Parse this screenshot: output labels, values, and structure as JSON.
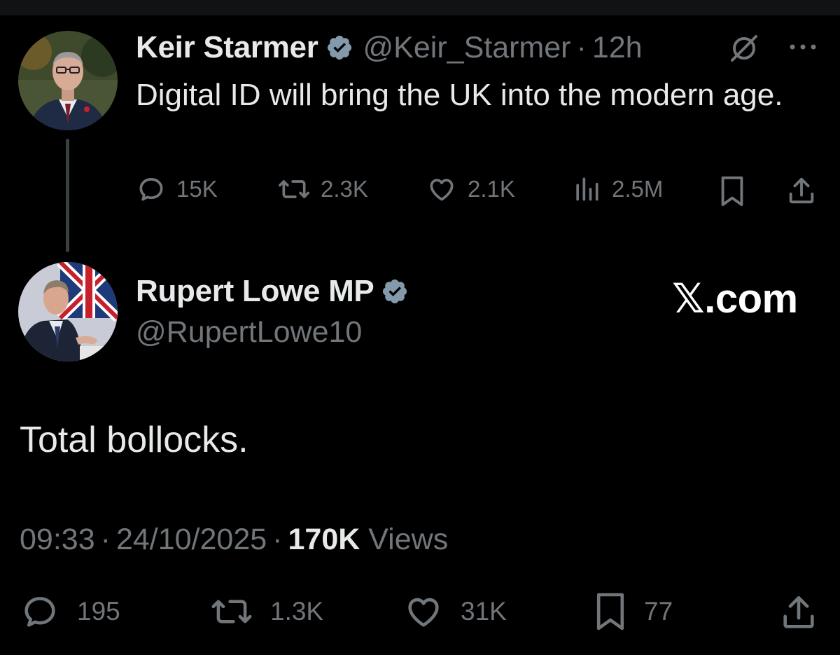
{
  "parent_tweet": {
    "author_name": "Keir Starmer",
    "handle": "@Keir_Starmer",
    "separator": "·",
    "time": "12h",
    "text": "Digital ID will bring the UK into the modern age.",
    "stats": {
      "replies": "15K",
      "reposts": "2.3K",
      "likes": "2.1K",
      "views": "2.5M"
    },
    "icons": [
      "reply-icon",
      "repost-icon",
      "like-icon",
      "views-icon",
      "bookmark-icon",
      "share-icon",
      "grok-icon",
      "more-icon",
      "verified-badge-icon"
    ]
  },
  "main_tweet": {
    "author_name": "Rupert Lowe MP",
    "handle": "@RupertLowe10",
    "text": "Total bollocks.",
    "time": "09:33",
    "separator": "·",
    "date": "24/10/2025",
    "views_count": "170K",
    "views_label": "Views",
    "stats": {
      "replies": "195",
      "reposts": "1.3K",
      "likes": "31K",
      "bookmarks": "77"
    }
  },
  "watermark": "𝕏.com",
  "colors": {
    "background": "#000000",
    "primary_text": "#e7e9ea",
    "secondary_text": "#71767b",
    "verified_badge": "#829aab",
    "thread_line": "#3b3f43"
  }
}
